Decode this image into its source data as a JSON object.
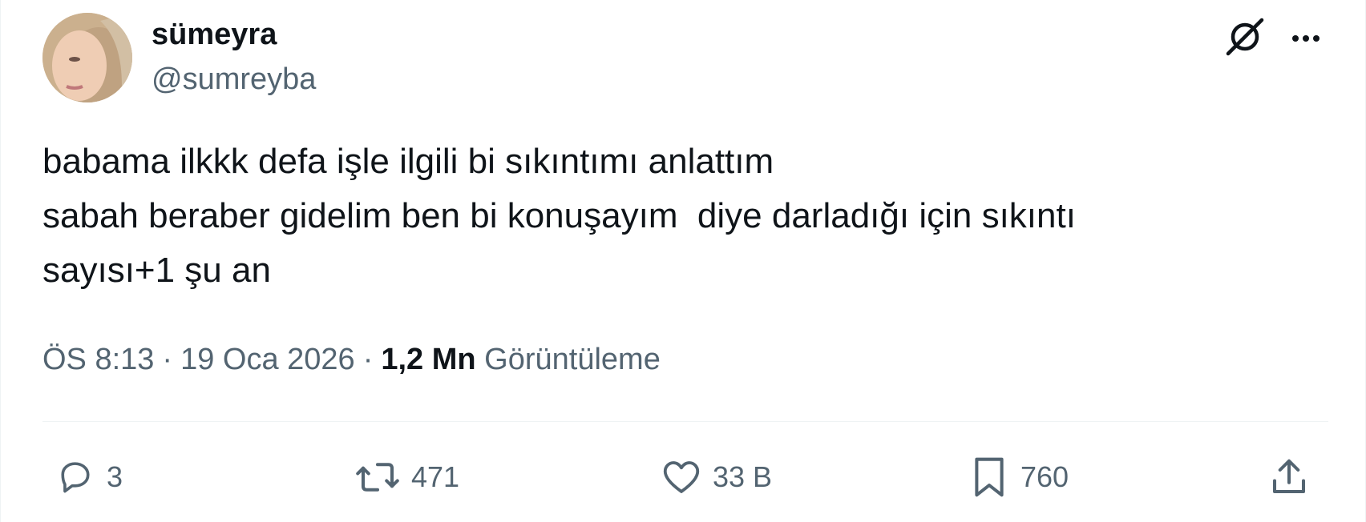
{
  "author": {
    "display_name": "sümeyra",
    "handle": "@sumreyba"
  },
  "tweet": {
    "lines": [
      "babama ilkkk defa işle ilgili bi sıkıntımı anlattım",
      "sabah beraber gidelim ben bi konuşayım  diye darladığı için sıkıntı",
      "sayısı+1 şu an"
    ]
  },
  "meta": {
    "time": "ÖS 8:13",
    "separator": "·",
    "date": "19 Oca 2026",
    "views_count": "1,2 Mn",
    "views_label": "Görüntüleme"
  },
  "actions": {
    "reply": {
      "icon": "reply-icon",
      "count": "3"
    },
    "retweet": {
      "icon": "retweet-icon",
      "count": "471"
    },
    "like": {
      "icon": "heart-icon",
      "count": "33 B"
    },
    "bookmark": {
      "icon": "bookmark-icon",
      "count": "760"
    },
    "share": {
      "icon": "share-icon"
    }
  },
  "header_icons": {
    "grok": "grok-icon",
    "more": "more-icon"
  },
  "colors": {
    "text_primary": "#0f1419",
    "text_secondary": "#536471",
    "divider": "#eff3f4",
    "background": "#ffffff"
  }
}
